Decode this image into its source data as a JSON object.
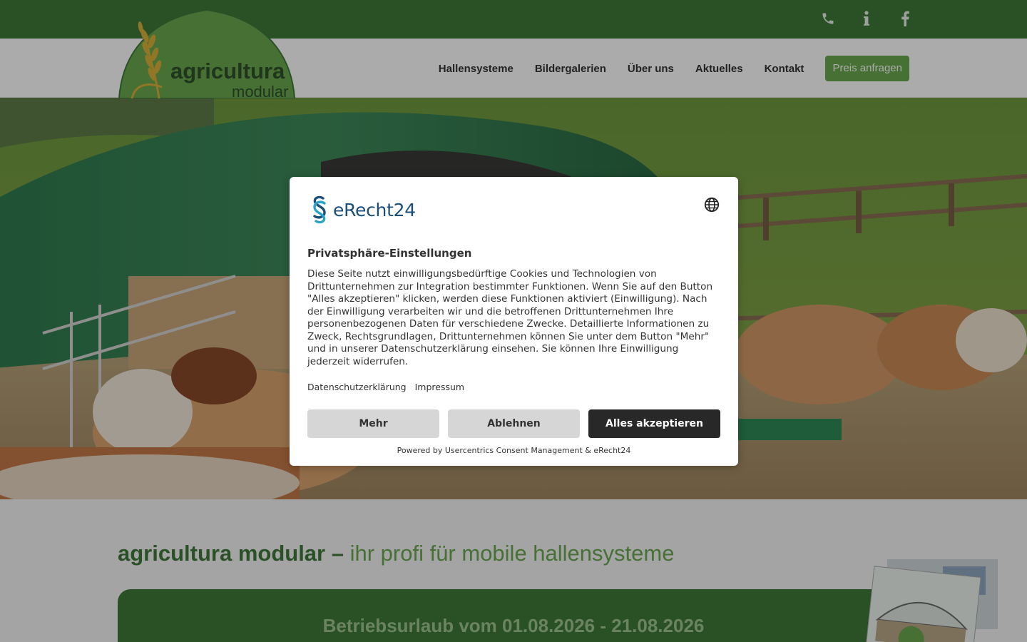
{
  "topbar": {
    "icons": [
      "phone-icon",
      "info-icon",
      "facebook-icon"
    ],
    "color": "#3f7a3a"
  },
  "logo": {
    "line1": "agricultura",
    "line2": "modular"
  },
  "nav": {
    "items": [
      "Hallensysteme",
      "Bildergalerien",
      "Über uns",
      "Aktuelles",
      "Kontakt"
    ],
    "cta_label": "Preis anfragen",
    "accent": "#6aa84f"
  },
  "content": {
    "headline_strong": "agricultura modular –",
    "headline_light": "ihr profi für mobile hallensysteme",
    "banner_text": "Betriebsurlaub vom 01.08.2026 - 21.08.2026"
  },
  "consent": {
    "brand": "eRecht24",
    "language_icon": "globe-icon",
    "title": "Privatsphäre-Einstellungen",
    "body": "Diese Seite nutzt einwilligungsbedürftige Cookies und Technologien von Drittunternehmen zur Integration bestimmter Funktionen. Wenn Sie auf den Button \"Alles akzeptieren\" klicken, werden diese Funktionen aktiviert (Einwilligung). Nach der Einwilligung verarbeiten wir und die betroffenen Drittunternehmen Ihre personenbezogenen Daten für verschiedene Zwecke. Detaillierte Informationen zu Zweck, Rechtsgrundlagen, Drittunternehmen können Sie unter dem Button \"Mehr\" und in unserer Datenschutzerklärung einsehen. Sie können Ihre Einwilligung jederzeit widerrufen.",
    "links": [
      "Datenschutzerklärung",
      "Impressum"
    ],
    "buttons": {
      "more": "Mehr",
      "decline": "Ablehnen",
      "accept": "Alles akzeptieren"
    },
    "powered_by": "Powered by Usercentrics Consent Management & eRecht24"
  }
}
